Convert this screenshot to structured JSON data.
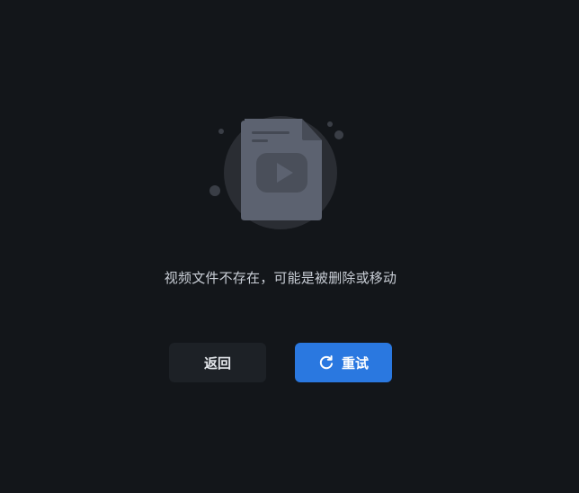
{
  "error": {
    "message": "视频文件不存在，可能是被删除或移动",
    "illustration_icon": "missing-video-file-icon"
  },
  "actions": {
    "back_label": "返回",
    "retry_label": "重试",
    "retry_icon": "refresh-icon"
  },
  "colors": {
    "background": "#13161a",
    "primary": "#2a78e0",
    "secondary_button": "#1d2126",
    "text": "#c9ced6"
  }
}
